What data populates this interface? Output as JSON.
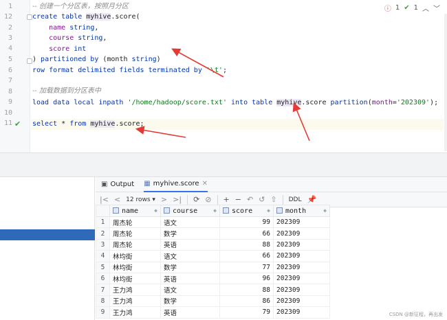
{
  "editor": {
    "line_numbers": [
      "1",
      "2",
      "3",
      "4",
      "5",
      "6",
      "7",
      "8",
      "9",
      "10",
      "11",
      "12"
    ],
    "comment1": "-- 创建一个分区表，按照月分区",
    "comment2": "-- 加载数据到分区表中",
    "inspection": {
      "warnings": "1",
      "checks": "1"
    }
  },
  "tabs": [
    {
      "label": "Output"
    },
    {
      "label": "myhive.score"
    }
  ],
  "toolbar": {
    "rows_label": "12 rows",
    "ddl_label": "DDL"
  },
  "table": {
    "columns": [
      "name",
      "course",
      "score",
      "month"
    ],
    "rows": [
      [
        "1",
        "周杰轮",
        "语文",
        "99",
        "202309"
      ],
      [
        "2",
        "周杰轮",
        "数学",
        "66",
        "202309"
      ],
      [
        "3",
        "周杰轮",
        "英语",
        "88",
        "202309"
      ],
      [
        "4",
        "林均街",
        "语文",
        "66",
        "202309"
      ],
      [
        "5",
        "林均街",
        "数学",
        "77",
        "202309"
      ],
      [
        "6",
        "林均街",
        "英语",
        "96",
        "202309"
      ],
      [
        "7",
        "王力鸿",
        "语文",
        "88",
        "202309"
      ],
      [
        "8",
        "王力鸿",
        "数学",
        "86",
        "202309"
      ],
      [
        "9",
        "王力鸿",
        "英语",
        "79",
        "202309"
      ]
    ]
  },
  "watermark": "CSDN @新征程，再出发",
  "colors": {
    "accent": "#3574f0",
    "arrow": "#e53935",
    "selection": "#2f6ab8"
  }
}
